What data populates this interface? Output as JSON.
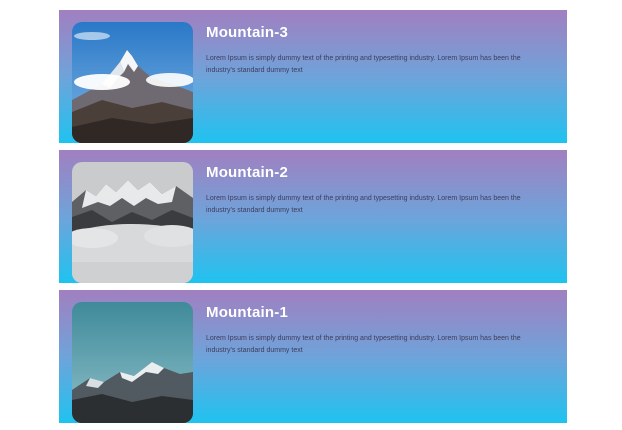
{
  "cards": [
    {
      "title": "Mountain-3",
      "description": "Lorem Ipsum is simply dummy text of the printing and typesetting industry. Lorem Ipsum has been the industry's standard dummy text",
      "image": "snowy-peak-blue-sky-photo"
    },
    {
      "title": "Mountain-2",
      "description": "Lorem Ipsum is simply dummy text of the printing and typesetting industry. Lorem Ipsum has been the industry's standard dummy text",
      "image": "misty-mountain-ridge-photo"
    },
    {
      "title": "Mountain-1",
      "description": "Lorem Ipsum is simply dummy text of the printing and typesetting industry. Lorem Ipsum has been the industry's standard dummy text",
      "image": "mountain-dusk-teal-sky-photo"
    }
  ],
  "colors": {
    "gradient_top": "#a17fc0",
    "gradient_bottom": "#1fc3f0",
    "title_text": "#ffffff",
    "body_text": "#3d3d5c"
  }
}
